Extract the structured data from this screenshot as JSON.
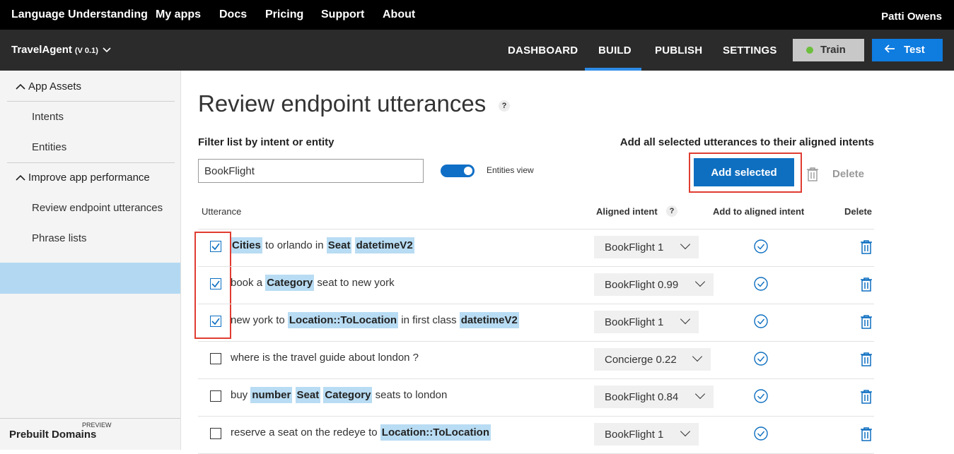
{
  "topnav": {
    "brand": "Language Understanding",
    "links": [
      "My apps",
      "Docs",
      "Pricing",
      "Support",
      "About"
    ],
    "user": "Patti Owens"
  },
  "appbar": {
    "app_name": "TravelAgent",
    "version": "(V 0.1)",
    "tabs": [
      "DASHBOARD",
      "BUILD",
      "PUBLISH",
      "SETTINGS"
    ],
    "active_tab": "BUILD",
    "train_label": "Train",
    "test_label": "Test"
  },
  "sidebar": {
    "section_app_assets": "App Assets",
    "item_intents": "Intents",
    "item_entities": "Entities",
    "section_improve": "Improve app performance",
    "item_review": "Review endpoint utterances",
    "item_phrase": "Phrase lists",
    "prebuilt_label": "Prebuilt Domains",
    "prebuilt_tag": "PREVIEW"
  },
  "main": {
    "title": "Review endpoint utterances",
    "help": "?",
    "filter_label": "Filter list by intent or entity",
    "filter_value": "BookFlight",
    "entities_view_label": "Entities view",
    "add_all_text": "Add all selected utterances to their aligned intents",
    "add_selected_label": "Add selected",
    "delete_label": "Delete",
    "headers": {
      "utterance": "Utterance",
      "aligned_intent": "Aligned intent",
      "add_to_aligned": "Add to aligned intent",
      "delete": "Delete"
    }
  },
  "rows": [
    {
      "checked": true,
      "segments": [
        {
          "text": "Cities",
          "entity": true
        },
        {
          "text": " to orlando in ",
          "entity": false
        },
        {
          "text": "Seat",
          "entity": true
        },
        {
          "text": " ",
          "entity": false
        },
        {
          "text": "datetimeV2",
          "entity": true
        }
      ],
      "intent": "BookFlight 1"
    },
    {
      "checked": true,
      "segments": [
        {
          "text": "book a ",
          "entity": false
        },
        {
          "text": "Category",
          "entity": true
        },
        {
          "text": " seat to new york",
          "entity": false
        }
      ],
      "intent": "BookFlight 0.99"
    },
    {
      "checked": true,
      "segments": [
        {
          "text": "new york to ",
          "entity": false
        },
        {
          "text": "Location::ToLocation",
          "entity": true
        },
        {
          "text": " in first class ",
          "entity": false
        },
        {
          "text": "datetimeV2",
          "entity": true
        }
      ],
      "intent": "BookFlight 1"
    },
    {
      "checked": false,
      "segments": [
        {
          "text": "where is the travel guide about london ?",
          "entity": false
        }
      ],
      "intent": "Concierge 0.22"
    },
    {
      "checked": false,
      "segments": [
        {
          "text": "buy ",
          "entity": false
        },
        {
          "text": "number",
          "entity": true
        },
        {
          "text": " ",
          "entity": false
        },
        {
          "text": "Seat",
          "entity": true
        },
        {
          "text": " ",
          "entity": false
        },
        {
          "text": "Category",
          "entity": true
        },
        {
          "text": " seats to london",
          "entity": false
        }
      ],
      "intent": "BookFlight 0.84"
    },
    {
      "checked": false,
      "segments": [
        {
          "text": "reserve a seat on the redeye to ",
          "entity": false
        },
        {
          "text": "Location::ToLocation",
          "entity": true
        }
      ],
      "intent": "BookFlight 1"
    }
  ]
}
